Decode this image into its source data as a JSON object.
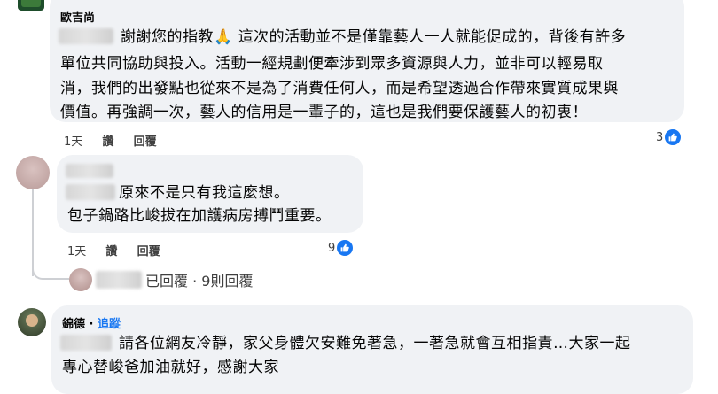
{
  "comments": [
    {
      "author": "歐吉尚",
      "lines": [
        "謝謝您的指教🙏 這次的活動並不是僅靠藝人一人就能促成的，背後有許多",
        "單位共同協助與投入。活動一經規劃便牽涉到眾多資源與人力，並非可以輕易取",
        "消，我們的出發點也從來不是為了消費任何人，而是希望透過合作帶來實質成果與",
        "價值。再強調一次，藝人的信用是一輩子的，這也是我們要保護藝人的初衷！"
      ],
      "time": "1天",
      "like": "讚",
      "reply": "回覆",
      "reactions": "3"
    },
    {
      "lines": [
        "原來不是只有我這麼想。",
        "包子鍋路比峻拔在加護病房搏鬥重要。"
      ],
      "time": "1天",
      "like": "讚",
      "reply": "回覆",
      "reactions": "9",
      "replies_summary": "已回覆 · 9則回覆"
    },
    {
      "author": "錦德",
      "follow": "追蹤",
      "separator": " · ",
      "lines": [
        "請各位網友冷靜，家父身體欠安難免著急，一著急就會互相指責…大家一起",
        "專心替峻爸加油就好，感謝大家"
      ]
    }
  ],
  "colors": {
    "bubble": "#f0f2f5",
    "like_blue": "#1877f2",
    "thread_line": "#ced0d4"
  }
}
